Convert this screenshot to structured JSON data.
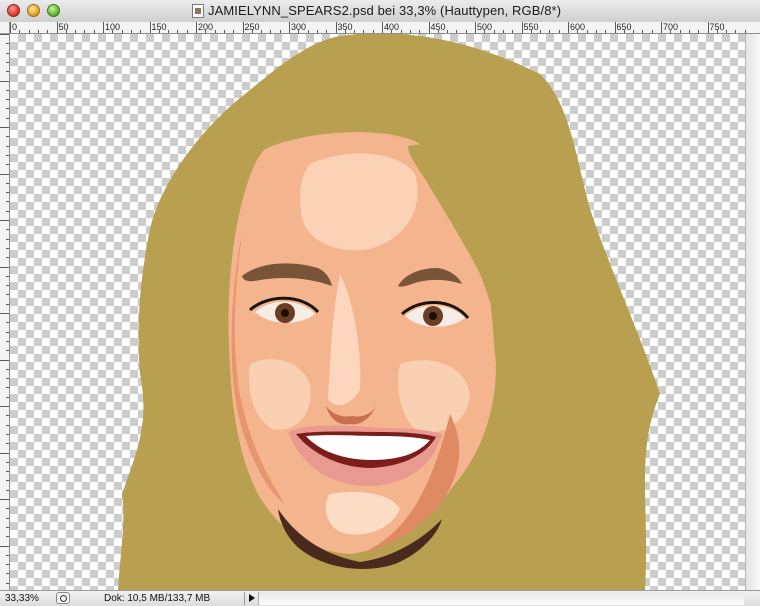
{
  "window": {
    "title": "JAMIELYNN_SPEARS2.psd bei 33,3% (Hauttypen, RGB/8*)"
  },
  "ruler": {
    "h_labels": [
      "0",
      "50",
      "100",
      "150",
      "200",
      "250",
      "300",
      "350",
      "400",
      "450",
      "500",
      "550",
      "600",
      "650",
      "700",
      "750"
    ]
  },
  "status": {
    "zoom": "33,33%",
    "doc_size": "Dok: 10,5 MB/133,7 MB"
  },
  "colors": {
    "hair": "#b8a050",
    "skin_base": "#f3b48e",
    "skin_light": "#fddcc6",
    "skin_shadow": "#e7956e",
    "brow": "#7a5438",
    "iris": "#6b3d22",
    "lips": "#e89a90",
    "teeth": "#ffffff",
    "neck_line": "#4a2a1c"
  },
  "icons": {
    "traffic_close": "close-button",
    "traffic_minimize": "minimize-button",
    "traffic_zoom": "zoom-button",
    "document": "psd-document-icon",
    "status_menu": "status-menu-icon",
    "status_arrow": "play-arrow-icon"
  }
}
